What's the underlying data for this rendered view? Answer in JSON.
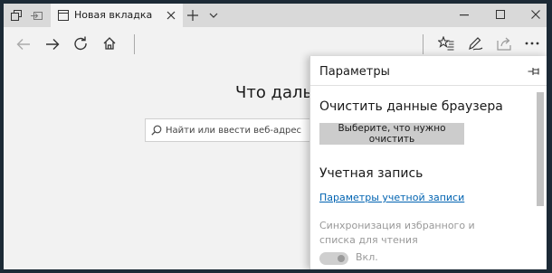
{
  "tab": {
    "title": "Новая вкладка"
  },
  "home": {
    "headline": "Что дальше?",
    "search_placeholder": "Найти или ввести веб-адрес"
  },
  "settings_panel": {
    "title": "Параметры",
    "clear_section_title": "Очистить данные браузера",
    "clear_button": "Выберите, что нужно очистить",
    "account_section_title": "Учетная запись",
    "account_link": "Параметры учетной записи",
    "sync_text": "Синхронизация избранного и списка для чтения",
    "sync_toggle_label": "Вкл."
  },
  "icons": {
    "tab_manager": "tab-manager-icon",
    "set_aside": "set-aside-tabs-icon",
    "tab_page": "page-icon",
    "tab_close": "close-icon",
    "new_tab": "plus-icon",
    "tab_list": "chevron-down-icon",
    "minimize": "minimize-icon",
    "maximize": "maximize-icon",
    "close_window": "close-window-icon",
    "back": "back-arrow-icon",
    "forward": "forward-arrow-icon",
    "refresh": "refresh-icon",
    "home": "home-icon",
    "favorites": "favorites-icon",
    "notes": "pen-icon",
    "share": "share-icon",
    "more": "more-icon",
    "pin": "pin-icon",
    "search": "search-icon"
  },
  "colors": {
    "titlebar": "#d9d9d9",
    "background": "#f2f2f2",
    "panel": "#ffffff",
    "link": "#0063b1",
    "button": "#cccccc"
  }
}
